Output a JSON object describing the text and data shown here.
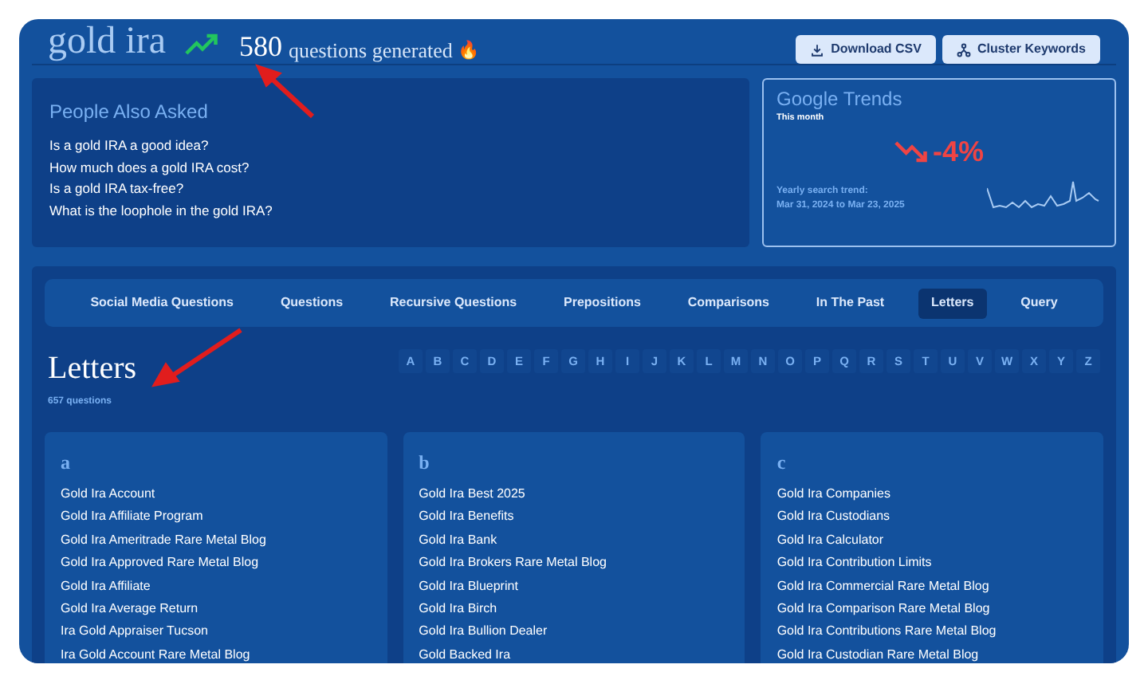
{
  "header": {
    "title": "gold ira",
    "count": "580",
    "count_label": "questions generated",
    "emoji": "🔥",
    "buttons": [
      {
        "label": "Download CSV",
        "kind": "download"
      },
      {
        "label": "Cluster Keywords",
        "kind": "cluster"
      }
    ]
  },
  "people_also_asked": {
    "title": "People Also Asked",
    "questions": [
      "Is a gold IRA a good idea?",
      "How much does a gold IRA cost?",
      "Is a gold IRA tax-free?",
      "What is the loophole in the gold IRA?"
    ]
  },
  "google_trends": {
    "title": "Google Trends",
    "period": "This month",
    "change": "-4%",
    "trend_label": "Yearly search trend:",
    "range": "Mar 31, 2024 to Mar 23, 2025"
  },
  "tabs": [
    {
      "label": "Social Media Questions",
      "selected": false
    },
    {
      "label": "Questions",
      "selected": false
    },
    {
      "label": "Recursive Questions",
      "selected": false
    },
    {
      "label": "Prepositions",
      "selected": false
    },
    {
      "label": "Comparisons",
      "selected": false
    },
    {
      "label": "In The Past",
      "selected": false
    },
    {
      "label": "Letters",
      "selected": true
    },
    {
      "label": "Query",
      "selected": false
    }
  ],
  "section": {
    "title": "Letters",
    "count": "657 questions"
  },
  "alphabet": [
    "A",
    "B",
    "C",
    "D",
    "E",
    "F",
    "G",
    "H",
    "I",
    "J",
    "K",
    "L",
    "M",
    "N",
    "O",
    "P",
    "Q",
    "R",
    "S",
    "T",
    "U",
    "V",
    "W",
    "X",
    "Y",
    "Z"
  ],
  "columns": [
    {
      "letter": "a",
      "items": [
        "Gold Ira Account",
        "Gold Ira Affiliate Program",
        "Gold Ira Ameritrade Rare Metal Blog",
        "Gold Ira Approved Rare Metal Blog",
        "Gold Ira Affiliate",
        "Gold Ira Average Return",
        "Ira Gold Appraiser Tucson",
        "Ira Gold Account Rare Metal Blog"
      ]
    },
    {
      "letter": "b",
      "items": [
        "Gold Ira Best 2025",
        "Gold Ira Benefits",
        "Gold Ira Bank",
        "Gold Ira Brokers Rare Metal Blog",
        "Gold Ira Blueprint",
        "Gold Ira Birch",
        "Gold Ira Bullion Dealer",
        "Gold Backed Ira"
      ]
    },
    {
      "letter": "c",
      "items": [
        "Gold Ira Companies",
        "Gold Ira Custodians",
        "Gold Ira Calculator",
        "Gold Ira Contribution Limits",
        "Gold Ira Commercial Rare Metal Blog",
        "Gold Ira Comparison Rare Metal Blog",
        "Gold Ira Contributions Rare Metal Blog",
        "Gold Ira Custodian Rare Metal Blog"
      ]
    }
  ]
}
